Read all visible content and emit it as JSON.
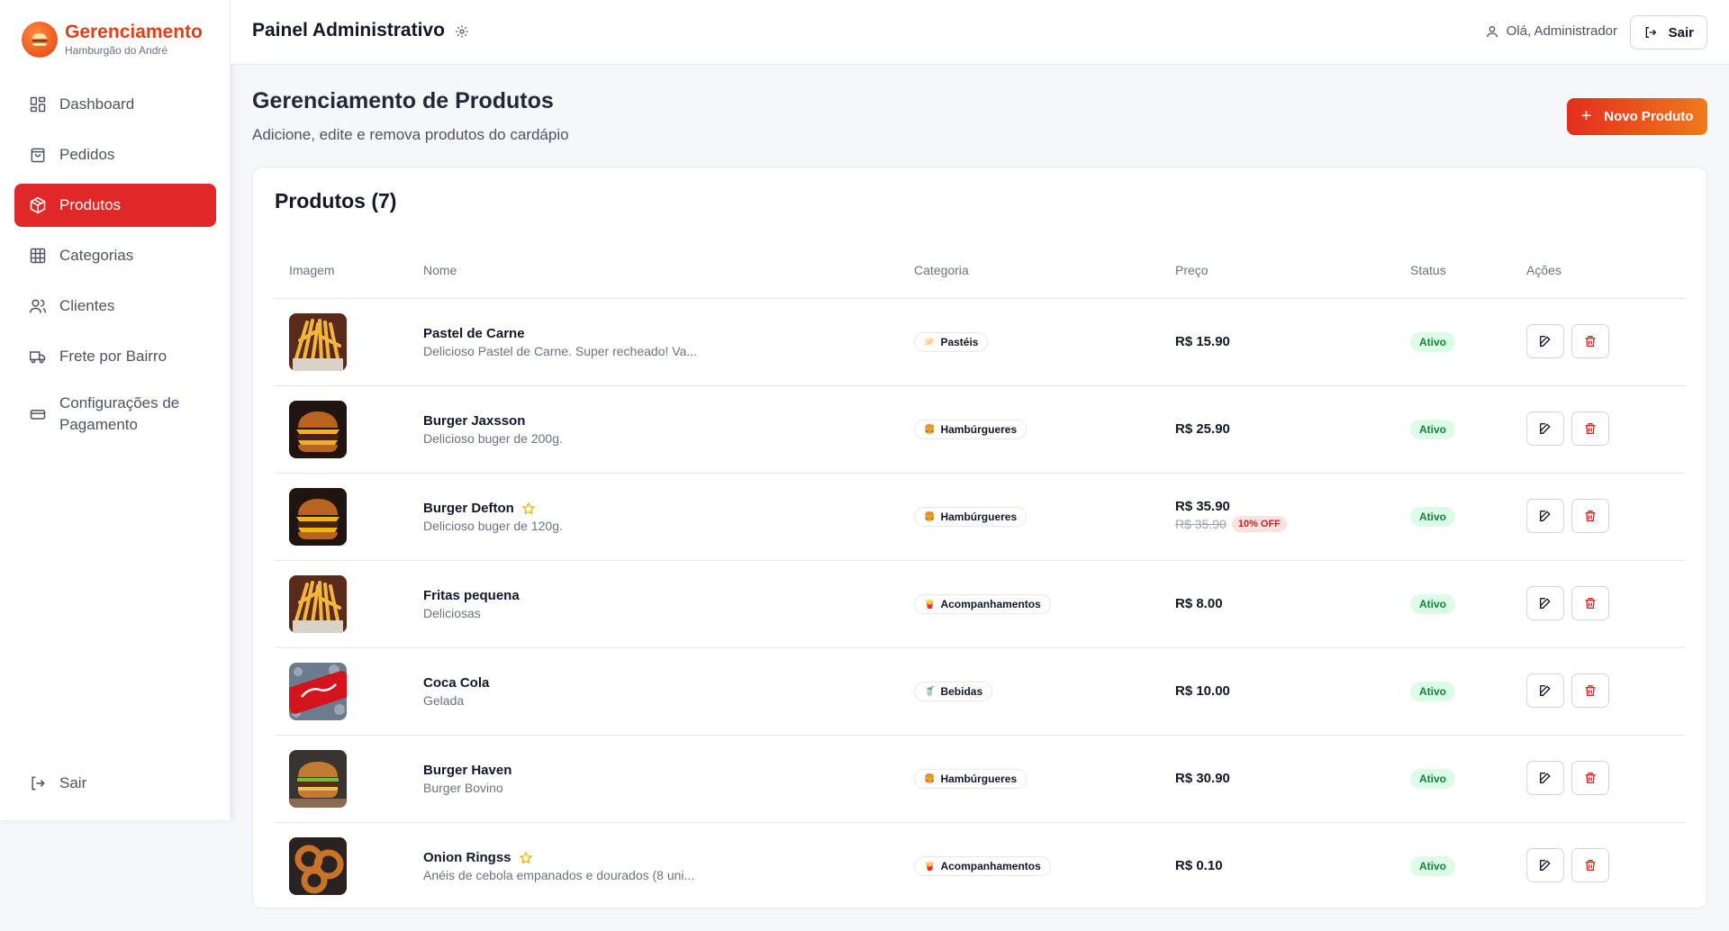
{
  "brand": {
    "title": "Gerenciamento",
    "subtitle": "Hamburgão do André"
  },
  "sidebar": {
    "items": [
      {
        "label": "Dashboard",
        "icon": "dashboard-icon"
      },
      {
        "label": "Pedidos",
        "icon": "shopping-bag-icon"
      },
      {
        "label": "Produtos",
        "icon": "package-icon",
        "active": true
      },
      {
        "label": "Categorias",
        "icon": "grid-icon"
      },
      {
        "label": "Clientes",
        "icon": "users-icon"
      },
      {
        "label": "Frete por Bairro",
        "icon": "truck-icon"
      },
      {
        "label": "Configurações de Pagamento",
        "icon": "credit-card-icon"
      }
    ],
    "logout_label": "Sair"
  },
  "header": {
    "title": "Painel Administrativo",
    "greeting": "Olá, Administrador",
    "logout_label": "Sair"
  },
  "page": {
    "title": "Gerenciamento de Produtos",
    "subtitle": "Adicione, edite e remova produtos do cardápio",
    "new_button": "Novo Produto"
  },
  "table": {
    "title": "Produtos (7)",
    "columns": [
      "Imagem",
      "Nome",
      "Categoria",
      "Preço",
      "Status",
      "Ações"
    ],
    "rows": [
      {
        "name": "Pastel de Carne",
        "description": "Delicioso Pastel de Carne. Super recheado! Va...",
        "category": "Pastéis",
        "category_emoji": "🥟",
        "price": "R$ 15.90",
        "status": "Ativo",
        "image": "fries",
        "featured": false
      },
      {
        "name": "Burger Jaxsson",
        "description": "Delicioso buger de 200g.",
        "category": "Hambúrgueres",
        "category_emoji": "🍔",
        "price": "R$ 25.90",
        "status": "Ativo",
        "image": "burger",
        "featured": false
      },
      {
        "name": "Burger Defton",
        "description": "Delicioso buger de 120g.",
        "category": "Hambúrgueres",
        "category_emoji": "🍔",
        "price": "R$ 35.90",
        "old_price": "R$ 35.90",
        "discount": "10% OFF",
        "status": "Ativo",
        "image": "burger",
        "featured": true
      },
      {
        "name": "Fritas pequena",
        "description": "Deliciosas",
        "category": "Acompanhamentos",
        "category_emoji": "🍟",
        "price": "R$ 8.00",
        "status": "Ativo",
        "image": "fries",
        "featured": false
      },
      {
        "name": "Coca Cola",
        "description": "Gelada",
        "category": "Bebidas",
        "category_emoji": "🥤",
        "price": "R$ 10.00",
        "status": "Ativo",
        "image": "coke",
        "featured": false
      },
      {
        "name": "Burger Haven",
        "description": "Burger Bovino",
        "category": "Hambúrgueres",
        "category_emoji": "🍔",
        "price": "R$ 30.90",
        "status": "Ativo",
        "image": "burger2",
        "featured": false
      },
      {
        "name": "Onion Ringss",
        "description": "Anéis de cebola empanados e dourados (8 uni...",
        "category": "Acompanhamentos",
        "category_emoji": "🍟",
        "price": "R$ 0.10",
        "status": "Ativo",
        "image": "rings",
        "featured": true
      }
    ]
  },
  "colors": {
    "accent": "#e02828",
    "brand": "#e23e18",
    "status_bg": "#dcfce7",
    "status_text": "#15803d",
    "star": "#eab308"
  }
}
